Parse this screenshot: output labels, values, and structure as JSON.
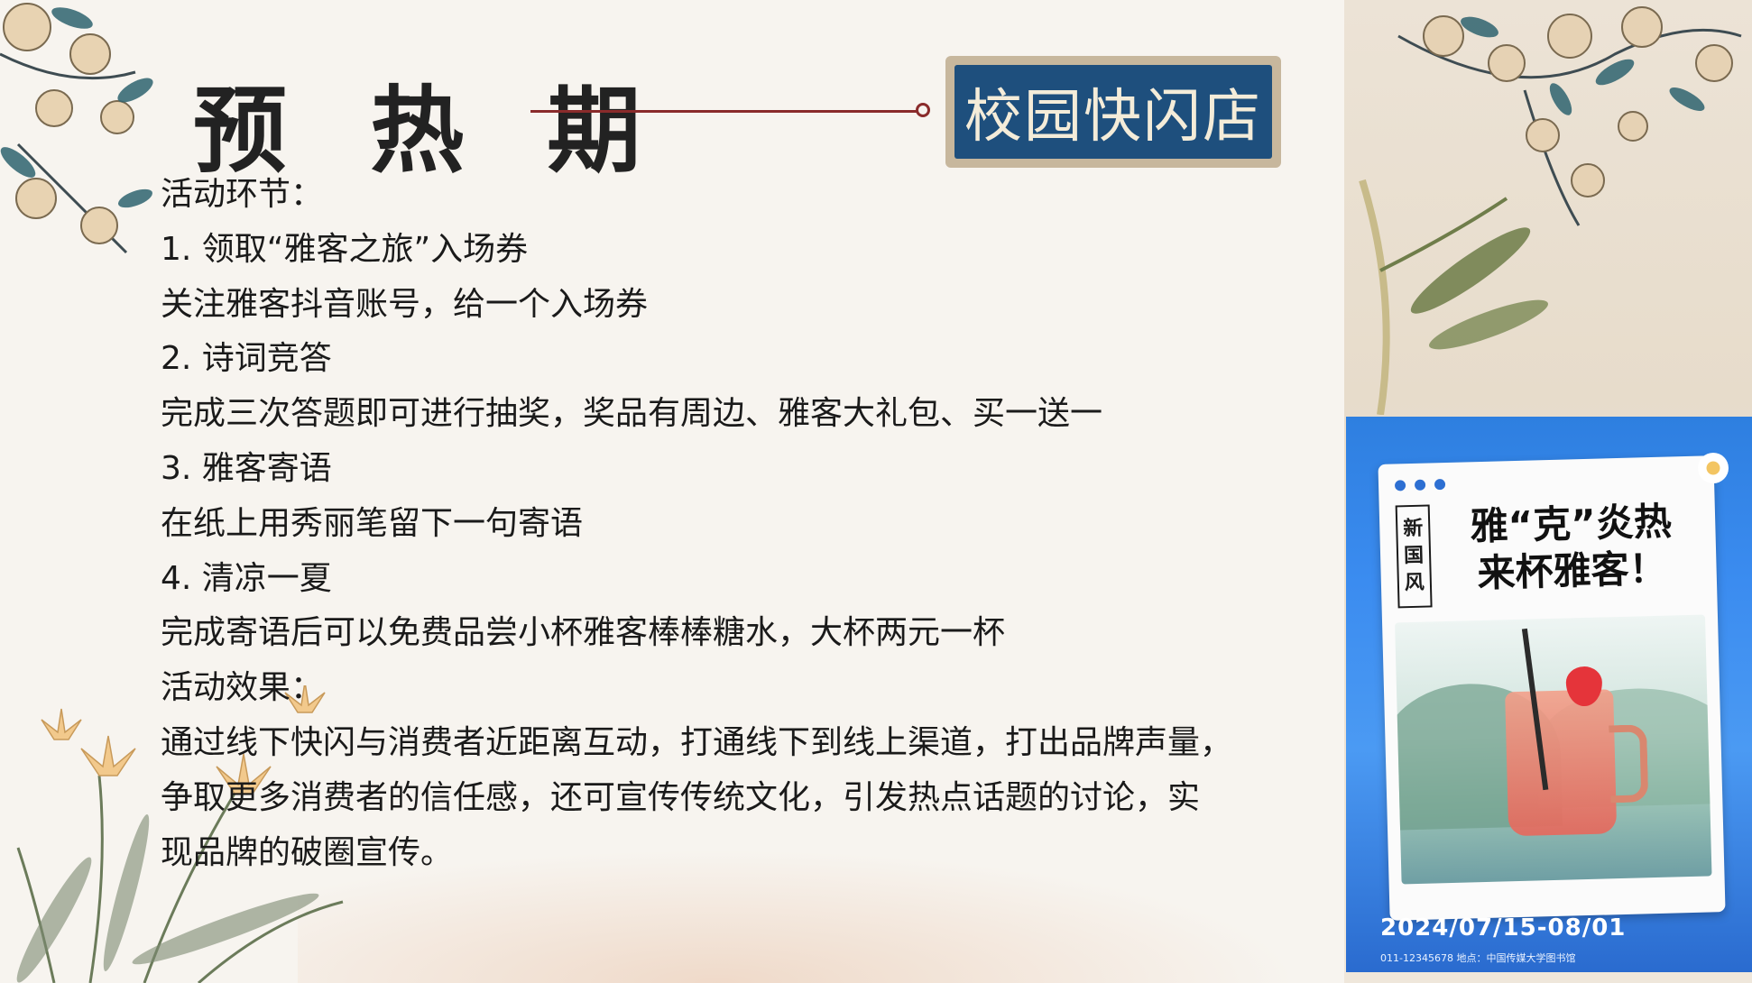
{
  "title": "预 热 期",
  "badge": "校园快闪店",
  "lines": [
    "活动环节：",
    "1. 领取“雅客之旅”入场券",
    "关注雅客抖音账号，给一个入场券",
    "2. 诗词竞答",
    "完成三次答题即可进行抽奖，奖品有周边、雅客大礼包、买一送一",
    "3. 雅客寄语",
    "在纸上用秀丽笔留下一句寄语",
    "4. 清凉一夏",
    "完成寄语后可以免费品尝小杯雅客棒棒糖水，大杯两元一杯",
    "活动效果：",
    "通过线下快闪与消费者近距离互动，打通线下到线上渠道，打出品牌声量，",
    "争取更多消费者的信任感，还可宣传传统文化，引发热点话题的讨论，实",
    "现品牌的破圈宣传。"
  ],
  "poster": {
    "tag": [
      "新",
      "国",
      "风"
    ],
    "headline_1": "雅“克”炎热",
    "headline_2": "来杯雅客！",
    "date": "2024/07/15-08/01",
    "contact": "011-12345678  地点：中国传媒大学图书馆"
  },
  "colors": {
    "badge_bg": "#1e4f7d",
    "connector": "#8a2b2b",
    "poster_bg": "#3b8cf0"
  }
}
